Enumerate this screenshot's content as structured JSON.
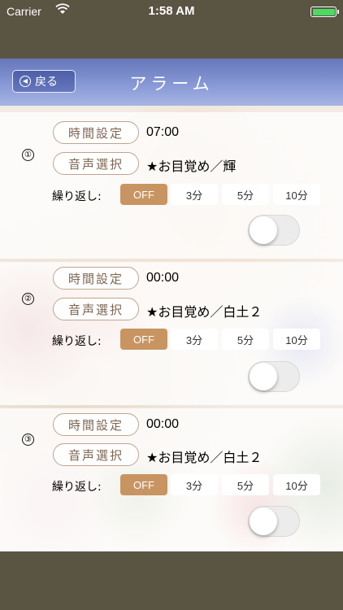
{
  "status": {
    "carrier": "Carrier",
    "time": "1:58 AM"
  },
  "nav": {
    "back_label": "戻る",
    "title": "アラーム"
  },
  "labels": {
    "time_setting": "時間設定",
    "sound_select": "音声選択",
    "repeat": "繰り返し:",
    "options": [
      "OFF",
      "3分",
      "5分",
      "10分"
    ]
  },
  "alarms": [
    {
      "number": "①",
      "time": "07:00",
      "sound": "★お目覚め／輝",
      "selected_option": "OFF",
      "enabled": false
    },
    {
      "number": "②",
      "time": "00:00",
      "sound": "★お目覚め／白土２",
      "selected_option": "OFF",
      "enabled": false
    },
    {
      "number": "③",
      "time": "00:00",
      "sound": "★お目覚め／白土２",
      "selected_option": "OFF",
      "enabled": false
    }
  ],
  "colors": {
    "accent": "#c89462",
    "nav": "#7f8fd0",
    "frame": "#5a5443"
  }
}
